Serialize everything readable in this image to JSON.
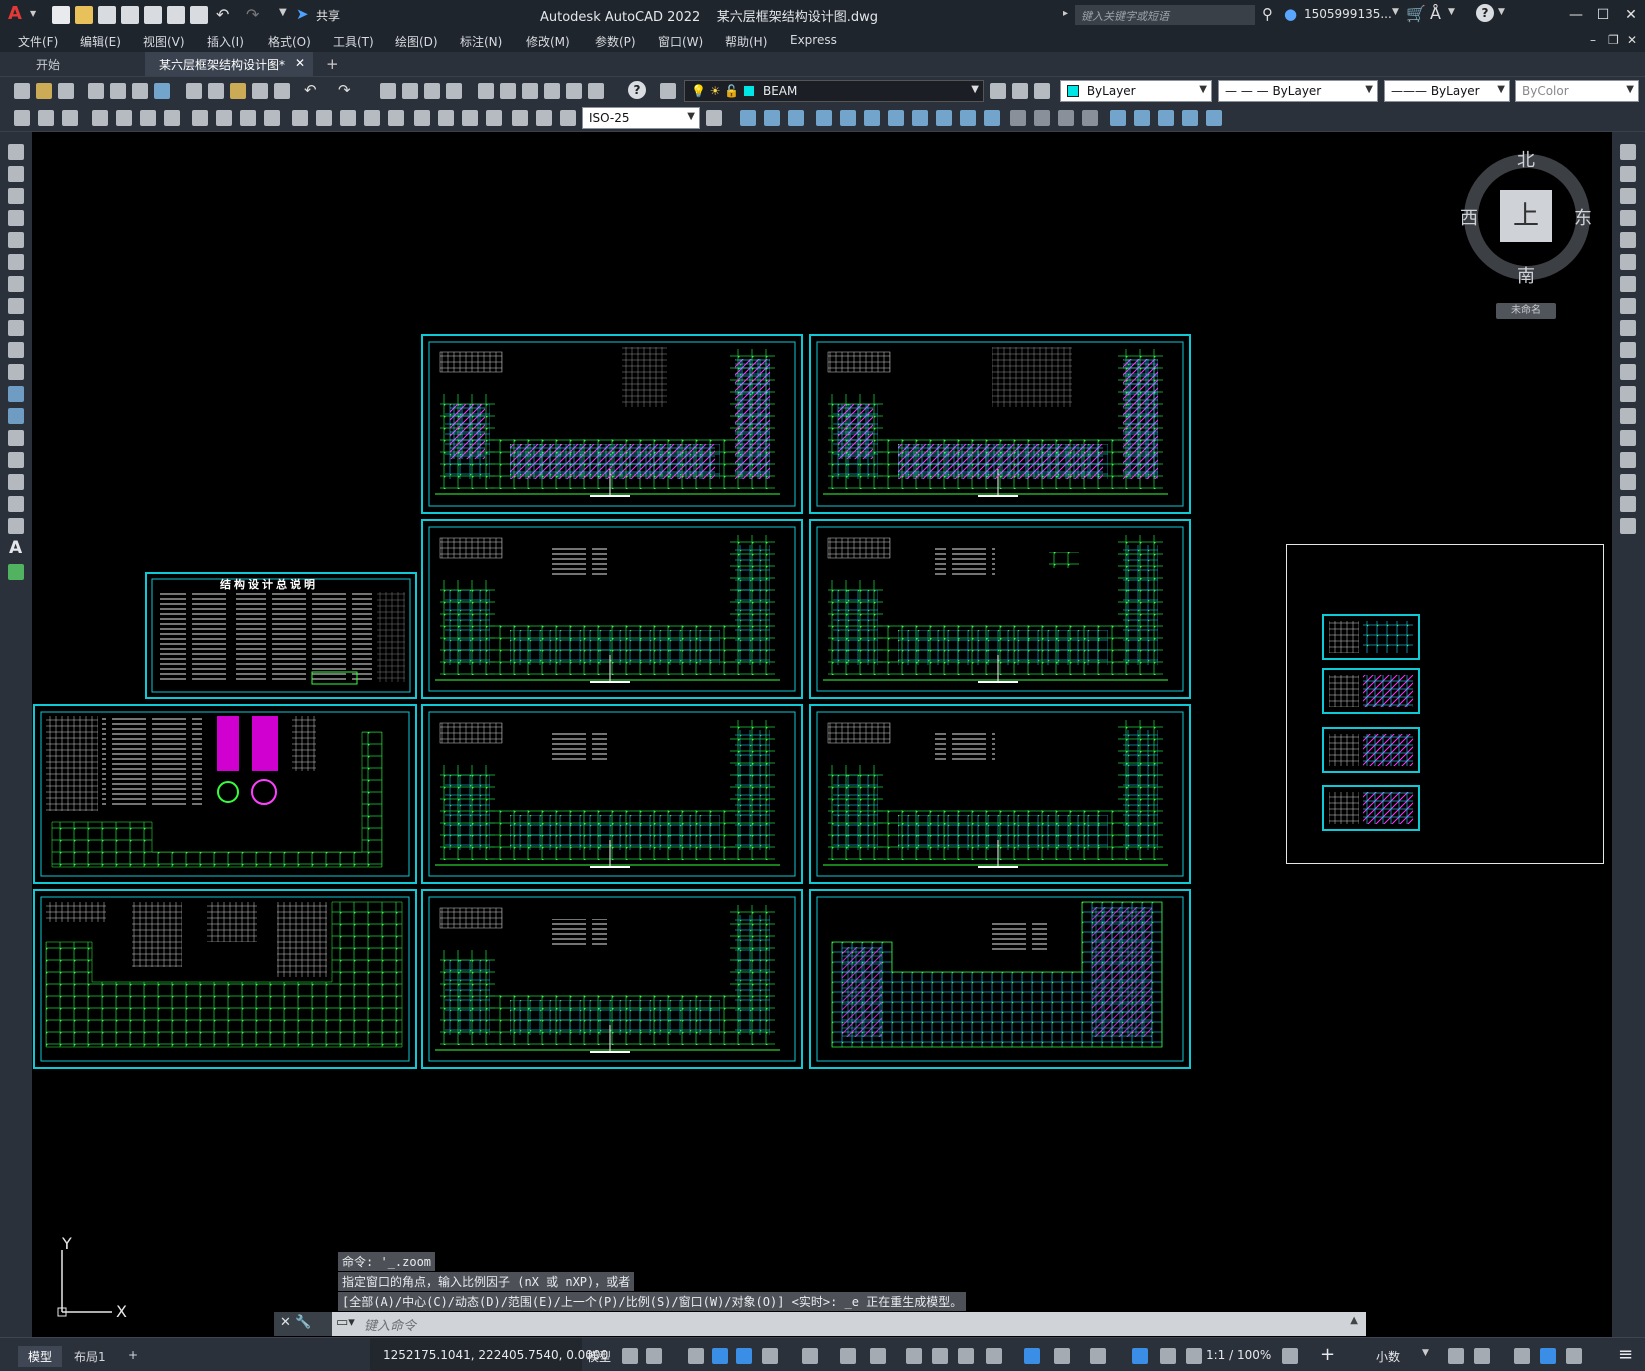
{
  "titlebar": {
    "app_title": "Autodesk AutoCAD 2022",
    "doc_title": "某六层框架结构设计图.dwg",
    "share_label": "共享",
    "search_placeholder": "键入关键字或短语",
    "user": "1505999135...",
    "logo": "A"
  },
  "menu": [
    "文件(F)",
    "编辑(E)",
    "视图(V)",
    "插入(I)",
    "格式(O)",
    "工具(T)",
    "绘图(D)",
    "标注(N)",
    "修改(M)",
    "参数(P)",
    "窗口(W)",
    "帮助(H)",
    "Express"
  ],
  "tabs": {
    "start": "开始",
    "doc": "某六层框架结构设计图*",
    "add": "+"
  },
  "toolbar": {
    "layer": "BEAM",
    "color": "ByLayer",
    "linetype": "— — — ByLayer",
    "lineweight": "——— ByLayer",
    "plotstyle": "ByColor",
    "dimstyle": "ISO-25",
    "layer_color": "#00e5e5",
    "color_swatch": "#00e5e5"
  },
  "viewcube": {
    "north": "北",
    "south": "南",
    "east": "东",
    "west": "西",
    "face": "上",
    "wcs": "未命名"
  },
  "ucs": {
    "y": "Y",
    "x": "X"
  },
  "command": {
    "history": [
      "命令: '_.zoom",
      "指定窗口的角点，输入比例因子 (nX 或 nXP)，或者",
      "[全部(A)/中心(C)/动态(D)/范围(E)/上一个(P)/比例(S)/窗口(W)/对象(O)] <实时>: _e 正在重生成模型。"
    ],
    "placeholder": "键入命令"
  },
  "status": {
    "tab_model": "模型",
    "tab_layout": "布局1",
    "add": "+",
    "coords": "1252175.1041, 222405.7540, 0.0000",
    "mode": "模型",
    "scale": "1:1 / 100%",
    "units": "小数"
  },
  "drawing": {
    "notes_title": "结构设计总说明"
  }
}
